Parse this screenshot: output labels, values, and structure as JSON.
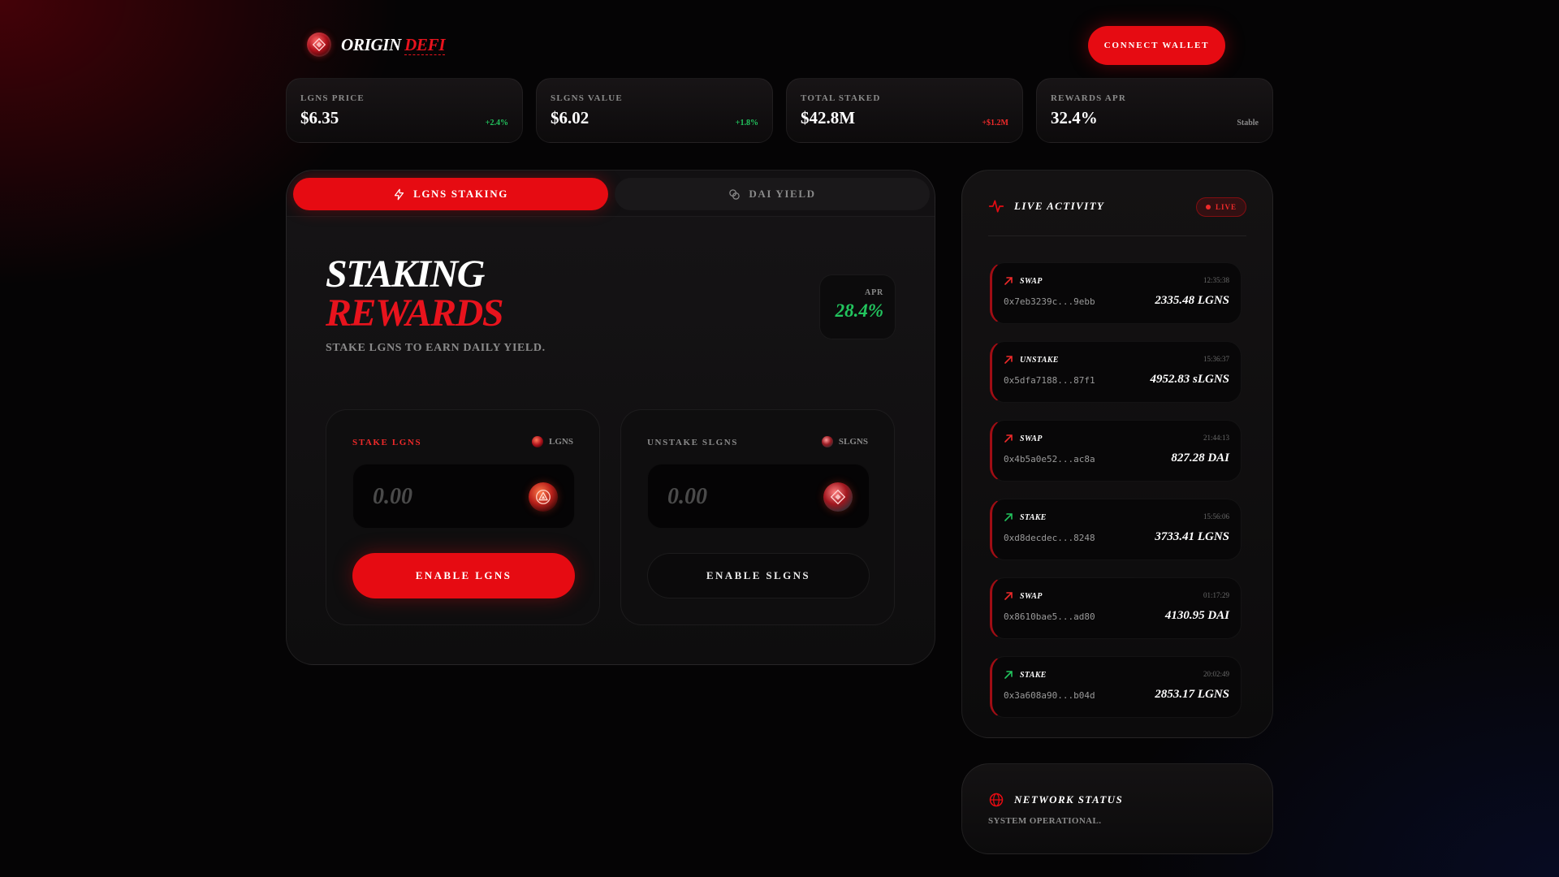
{
  "header": {
    "brand_primary": "ORIGIN",
    "brand_accent": "DEFI",
    "connect_label": "CONNECT WALLET"
  },
  "stats": [
    {
      "label": "LGNS PRICE",
      "value": "$6.35",
      "change": "+2.4%",
      "tone": "green"
    },
    {
      "label": "SLGNS VALUE",
      "value": "$6.02",
      "change": "+1.8%",
      "tone": "green"
    },
    {
      "label": "TOTAL STAKED",
      "value": "$42.8M",
      "change": "+$1.2M",
      "tone": "red"
    },
    {
      "label": "REWARDS APR",
      "value": "32.4%",
      "change": "Stable",
      "tone": "grey"
    }
  ],
  "tabs": {
    "staking_label": "LGNS STAKING",
    "yield_label": "DAI YIELD"
  },
  "staking": {
    "title_line1": "STAKING",
    "title_line2": "REWARDS",
    "subtitle": "STAKE LGNS TO EARN DAILY YIELD.",
    "apr_label": "APR",
    "apr_value": "28.4%",
    "stake_card": {
      "label": "STAKE LGNS",
      "token": "LGNS",
      "placeholder": "0.00",
      "button": "ENABLE LGNS"
    },
    "unstake_card": {
      "label": "UNSTAKE SLGNS",
      "token": "SLGNS",
      "placeholder": "0.00",
      "button": "ENABLE SLGNS"
    }
  },
  "activity": {
    "title": "LIVE ACTIVITY",
    "badge": "LIVE",
    "items": [
      {
        "type": "SWAP",
        "time": "12:35:38",
        "hash": "0x7eb3239c...9ebb",
        "amount": "2335.48 LGNS",
        "direction": "out"
      },
      {
        "type": "UNSTAKE",
        "time": "15:36:37",
        "hash": "0x5dfa7188...87f1",
        "amount": "4952.83 sLGNS",
        "direction": "out"
      },
      {
        "type": "SWAP",
        "time": "21:44:13",
        "hash": "0x4b5a0e52...ac8a",
        "amount": "827.28 DAI",
        "direction": "out"
      },
      {
        "type": "STAKE",
        "time": "15:56:06",
        "hash": "0xd8decdec...8248",
        "amount": "3733.41 LGNS",
        "direction": "in"
      },
      {
        "type": "SWAP",
        "time": "01:17:29",
        "hash": "0x8610bae5...ad80",
        "amount": "4130.95 DAI",
        "direction": "out"
      },
      {
        "type": "STAKE",
        "time": "20:02:49",
        "hash": "0x3a608a90...b04d",
        "amount": "2853.17 LGNS",
        "direction": "in"
      }
    ]
  },
  "network": {
    "title": "NETWORK STATUS",
    "status": "SYSTEM OPERATIONAL."
  },
  "colors": {
    "accent": "#e60b12",
    "positive": "#22c55e",
    "negative": "#ef2a2a",
    "muted": "#8a8a8a"
  }
}
